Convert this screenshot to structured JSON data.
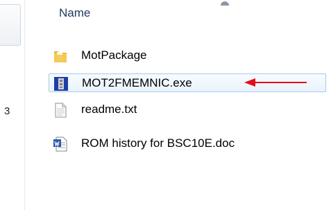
{
  "left_pane": {
    "glyph": "3"
  },
  "file_list": {
    "column_header": "Name",
    "items": [
      {
        "name": "MotPackage",
        "icon": "folder-icon",
        "selected": false
      },
      {
        "name": "MOT2FMEMNIC.exe",
        "icon": "exe-icon",
        "selected": true
      },
      {
        "name": "readme.txt",
        "icon": "text-file-icon",
        "selected": false
      },
      {
        "name": "ROM history for BSC10E.doc",
        "icon": "word-doc-icon",
        "selected": false
      }
    ]
  },
  "colors": {
    "header_text": "#1e395b",
    "selection_border": "#a8c8ec",
    "arrow": "#e0101a"
  }
}
